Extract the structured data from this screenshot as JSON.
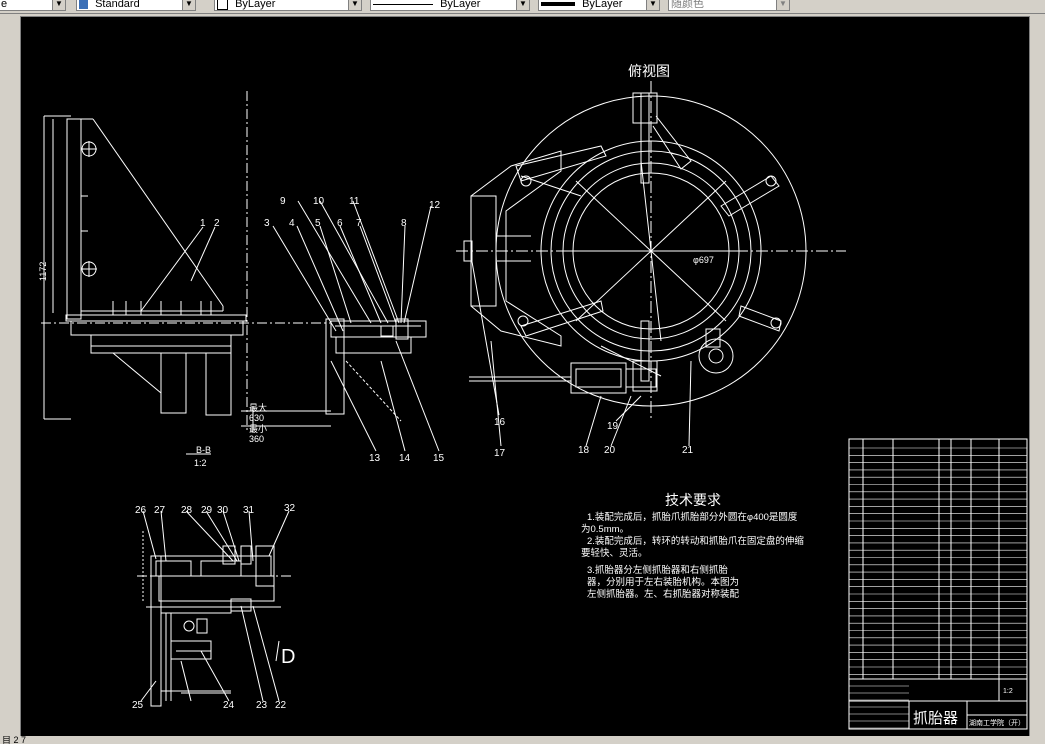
{
  "toolbar": {
    "linetype_prefix": "e",
    "textstyle": "Standard",
    "layer": "ByLayer",
    "linetype": "ByLayer",
    "lineweight": "ByLayer",
    "plotstyle": "随颜色"
  },
  "status": {
    "text": "目 2 7"
  },
  "drawing": {
    "view_title": "俯视图",
    "section_label": "B-B",
    "section_scale": "1:2",
    "dim_height": "1172",
    "dim_max_label": "最大",
    "dim_max_value": "630",
    "dim_min_label": "最小",
    "dim_min_value": "360",
    "dim_diameter": "φ697",
    "view_arrow": "D",
    "callouts_top": [
      "1",
      "2",
      "3",
      "4",
      "5",
      "6",
      "7",
      "8",
      "9",
      "10",
      "11",
      "12"
    ],
    "callouts_bottom": [
      "13",
      "14",
      "15",
      "16",
      "17",
      "18",
      "19",
      "20",
      "21"
    ],
    "callouts_detail_top": [
      "26",
      "27",
      "28",
      "29",
      "30",
      "31",
      "32"
    ],
    "callouts_detail_bottom": [
      "25",
      "24",
      "23",
      "22"
    ],
    "tech_title": "技术要求",
    "tech_lines": [
      "1.装配完成后，抓胎爪抓胎部分外圆在φ400是圆度",
      "为0.5mm。",
      "2.装配完成后，转环的转动和抓胎爪在固定盘的伸缩",
      "要轻快、灵活。",
      "3.抓胎器分左侧抓胎器和右侧抓胎",
      "器，分别用于左右装胎机构。本图为",
      "左侧抓胎器。左、右抓胎器对称装配"
    ],
    "title_block_name": "抓胎器",
    "title_block_org": "湖南工学院（开）",
    "title_block_scale": "1:2"
  }
}
